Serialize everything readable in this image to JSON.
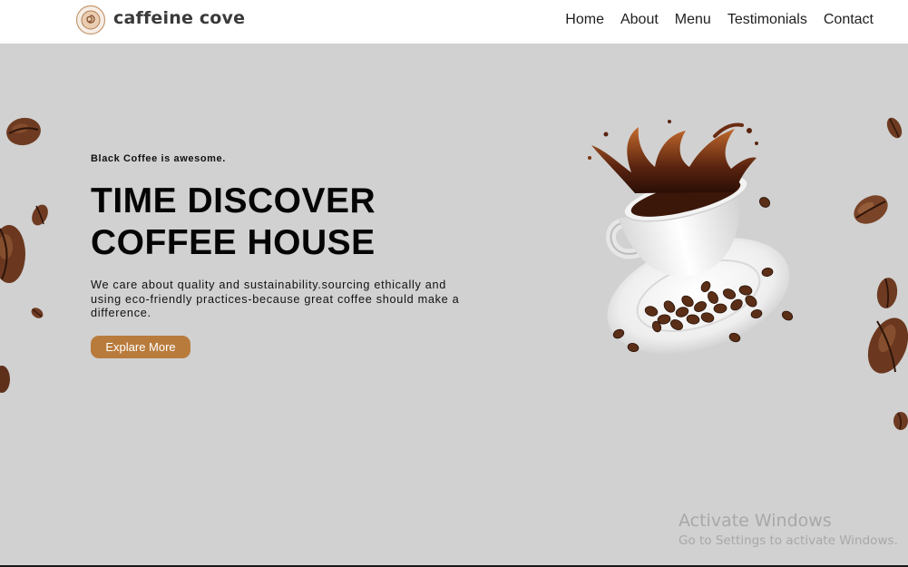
{
  "brand": {
    "name": "caffeine cove"
  },
  "nav": {
    "items": [
      {
        "label": "Home"
      },
      {
        "label": "About"
      },
      {
        "label": "Menu"
      },
      {
        "label": "Testimonials"
      },
      {
        "label": "Contact"
      }
    ]
  },
  "hero": {
    "eyebrow": "Black Coffee is awesome.",
    "headline_line1": "TIME DISCOVER",
    "headline_line2": "COFFEE HOUSE",
    "description": "We care about quality and sustainability.sourcing ethically and using eco-friendly practices-because great coffee should make a difference.",
    "cta_label": "Explare More"
  },
  "colors": {
    "hero_background": "#d1d1d1",
    "header_background": "#ffffff",
    "cta_background": "#b97b3c",
    "bean_brown": "#6b3a22"
  },
  "icons": {
    "logo": "coffee-swirl-icon",
    "hero_image": "coffee-cup-splash-illustration",
    "decoration": "coffee-bean-icon"
  },
  "watermark": {
    "title": "Activate Windows",
    "subtitle": "Go to Settings to activate Windows."
  }
}
